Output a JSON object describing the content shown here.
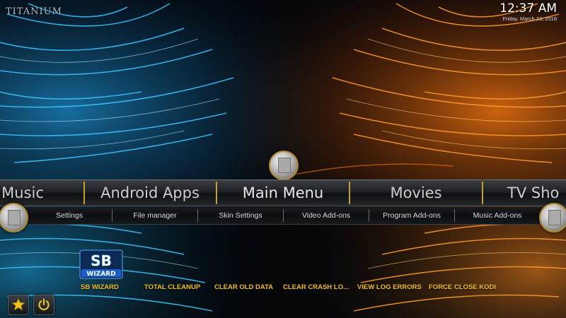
{
  "logo": {
    "text": "TITANIUM"
  },
  "clock": {
    "time": "12:37 AM",
    "date": "Friday, March 23, 2018"
  },
  "main_menu": {
    "items": [
      "Music",
      "Android Apps",
      "Main Menu",
      "Movies",
      "TV Sho"
    ],
    "selected": "Main Menu"
  },
  "sub_menu": {
    "items": [
      "Settings",
      "File manager",
      "Skin Settings",
      "Video Add-ons",
      "Program Add-ons",
      "Music Add-ons"
    ]
  },
  "wizard": {
    "logo_top": "SB",
    "logo_bottom": "WIZARD"
  },
  "shortcuts": [
    "SB WIZARD",
    "TOTAL CLEANUP",
    "CLEAR OLD DATA",
    "CLEAR CRASH LO...",
    "VIEW LOG ERRORS",
    "FORCE CLOSE KODI"
  ],
  "buttons": {
    "favourites_icon": "star-icon",
    "power_icon": "power-icon"
  },
  "colors": {
    "accent": "#f0c020",
    "left_glow": "#1fa9e8",
    "right_glow": "#ff7a10"
  }
}
